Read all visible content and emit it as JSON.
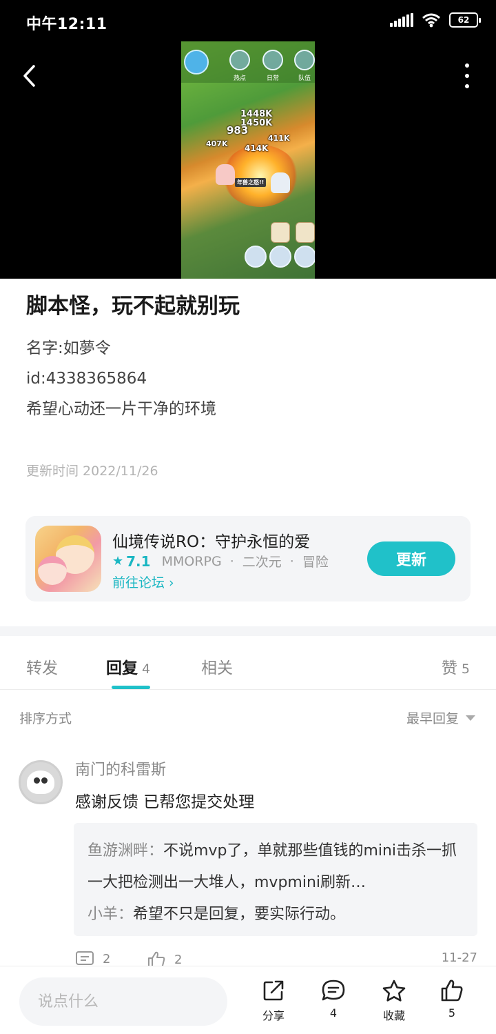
{
  "status_bar": {
    "time": "中午12:11",
    "battery": "62"
  },
  "video": {
    "labels": [
      "热点",
      "日常",
      "队伍"
    ],
    "damage": [
      "1448K",
      "1450K",
      "983",
      "407K",
      "411K",
      "414K"
    ],
    "banner": "年兽之怒!!"
  },
  "post": {
    "title": "脚本怪，玩不起就别玩",
    "lines": [
      "名字:如夢令",
      "id:4338365864",
      "希望心动还一片干净的环境"
    ],
    "update_time": "更新时间 2022/11/26"
  },
  "game_card": {
    "name": "仙境传说RO：守护永恒的爱",
    "rating": "7.1",
    "tags": [
      "MMORPG",
      "二次元",
      "冒险"
    ],
    "forum_link": "前往论坛 ›",
    "update_button": "更新"
  },
  "tabs": [
    {
      "label": "转发",
      "count": ""
    },
    {
      "label": "回复",
      "count": "4"
    },
    {
      "label": "相关",
      "count": ""
    },
    {
      "label": "赞",
      "count": "5"
    }
  ],
  "sort": {
    "label": "排序方式",
    "selected": "最早回复"
  },
  "comment": {
    "author": "南门的科雷斯",
    "text": "感谢反馈 已帮您提交处理",
    "replies": [
      {
        "author": "鱼游渊畔",
        "text": "不说mvp了，单就那些值钱的mini击杀一抓一大把检测出一大堆人，mvpmini刷新…"
      },
      {
        "author": "小羊",
        "text": "希望不只是回复，要实际行动。"
      }
    ],
    "reply_count": "2",
    "like_count": "2",
    "date": "11-27"
  },
  "bottom_bar": {
    "input_placeholder": "说点什么",
    "share_label": "分享",
    "comment_count": "4",
    "favorite_label": "收藏",
    "like_count": "5"
  },
  "colors": {
    "accent": "#20c1c9",
    "background": "#ffffff",
    "video_background": "#000000"
  }
}
